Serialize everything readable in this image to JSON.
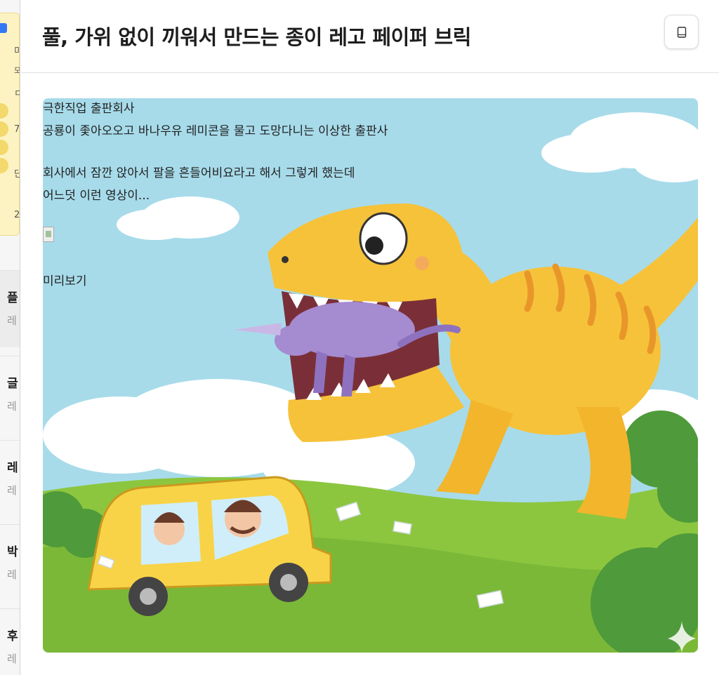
{
  "header": {
    "title": "풀, 가위 없이 끼워서 만드는 종이 레고 페이퍼 브릭",
    "reader_icon": "book-icon"
  },
  "sidebar": {
    "note": {
      "lines": [
        "미",
        "모",
        "ㅁ",
        "ㅣ",
        "7",
        "단",
        "2"
      ]
    },
    "items": [
      {
        "title": "플",
        "subtitle": "레"
      },
      {
        "title": "글",
        "subtitle": "레"
      },
      {
        "title": "레",
        "subtitle": "레"
      },
      {
        "title": "박",
        "subtitle": "레"
      },
      {
        "title": "후",
        "subtitle": "레"
      }
    ]
  },
  "content": {
    "lines": [
      "극한직업 출판회사",
      "공룡이 좇아오오고 바나우유 레미콘을 물고 도망다니는 이상한 출판사",
      "회사에서 잠깐 앉아서 팔을 흔들어비요라고 해서 그렇게 했는데",
      "어느덧 이런 영상이..."
    ],
    "image_alt": "",
    "caption": "미리보기",
    "illustration": "cartoon-dinosaur-chasing-car",
    "sparkle_icon": "sparkle-icon"
  },
  "colors": {
    "sky": "#9fd6e6",
    "grass": "#8cc63f",
    "dinosaur": "#f6c23a",
    "car": "#f8d347",
    "unicorn": "#a58bd0"
  }
}
